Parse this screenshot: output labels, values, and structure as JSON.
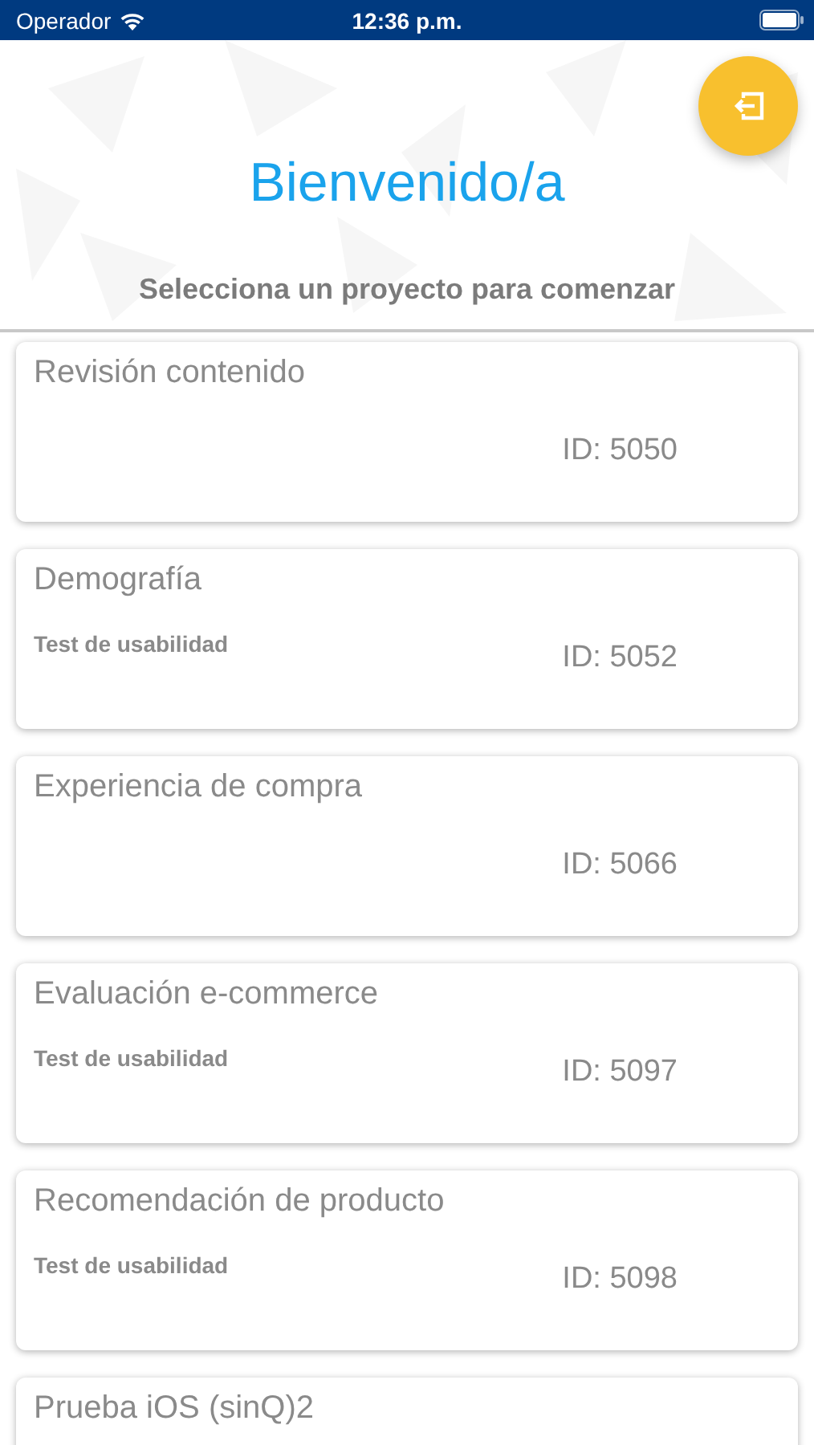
{
  "status_bar": {
    "carrier": "Operador",
    "time": "12:36 p.m."
  },
  "header": {
    "title": "Bienvenido/a",
    "subtitle": "Selecciona un proyecto para comenzar"
  },
  "projects": [
    {
      "name": "Revisión contenido",
      "id": "ID: 5050"
    },
    {
      "name": "Demografía",
      "type": "Test de usabilidad",
      "id": "ID: 5052"
    },
    {
      "name": "Experiencia de compra",
      "id": "ID: 5066"
    },
    {
      "name": "Evaluación e-commerce",
      "type": "Test de usabilidad",
      "id": "ID: 5097"
    },
    {
      "name": "Recomendación de producto",
      "type": "Test de usabilidad",
      "id": "ID: 5098"
    },
    {
      "name": "Prueba iOS (sinQ)2"
    }
  ]
}
